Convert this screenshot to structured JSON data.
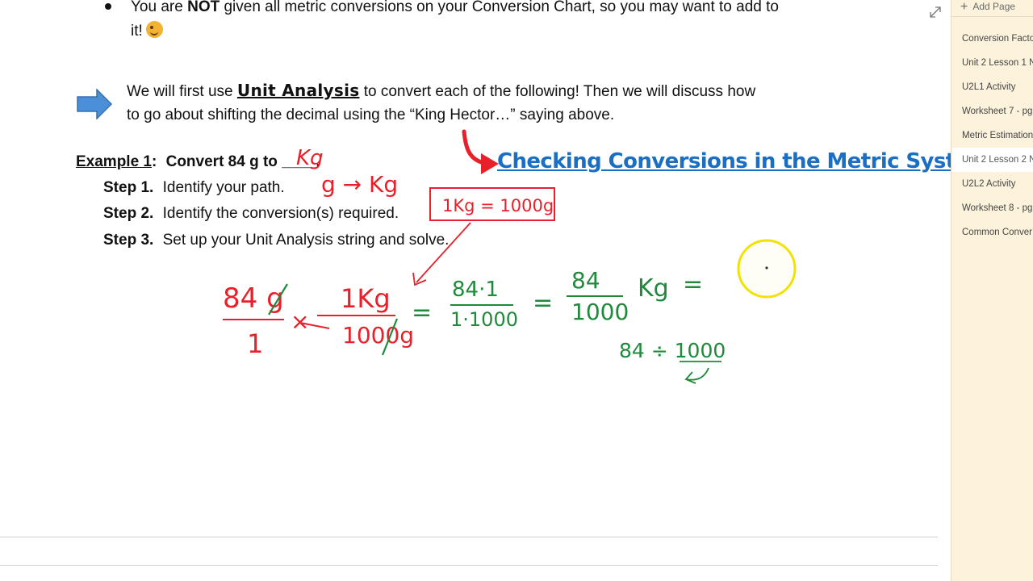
{
  "bullet": {
    "line1_a": "You are ",
    "line1_bold": "NOT",
    "line1_b": " given all metric conversions on your Conversion Chart, so you may want to add to",
    "line2": "it!",
    "emoji_icon": "winking-face-icon"
  },
  "intro": {
    "arrow_icon": "right-arrow-icon",
    "line1_a": "We will first use ",
    "line1_bold": "Unit Analysis",
    "line1_b": " to convert each of the following!  Then we will discuss how",
    "line2": "to go about shifting the decimal using the “King Hector…” saying above."
  },
  "example": {
    "label": "Example 1",
    "colon": ":",
    "title": "Convert 84 g to",
    "blank": "____",
    "period": ".",
    "steps": [
      {
        "num": "Step 1.",
        "text": "Identify your path."
      },
      {
        "num": "Step 2.",
        "text": "Identify the conversion(s) required."
      },
      {
        "num": "Step 3.",
        "text": "Set up your Unit Analysis string and solve."
      }
    ]
  },
  "link": {
    "text": "Checking Conversions in the Metric System"
  },
  "ink": {
    "blank_fill": "Kg",
    "path": "g → Kg",
    "box": "1Kg = 1000g",
    "frac1_num": "84 g",
    "frac1_den": "1",
    "times": "×",
    "frac2_num": "1Kg",
    "frac2_den": "1000g",
    "eq": "=",
    "frac3_num": "84·1",
    "frac3_den": "1·1000",
    "frac4_num": "84",
    "frac4_den": "1000",
    "unit": "Kg",
    "green_line": "84 ÷ 1000",
    "red_color": "#e8202a",
    "green_color": "#1f8a3c",
    "cursor_color": "#f2e200"
  },
  "sidebar": {
    "add_page": "Add Page",
    "pages": [
      {
        "label": "Conversion Factors",
        "selected": false
      },
      {
        "label": "Unit 2 Lesson 1 N",
        "selected": false
      },
      {
        "label": "U2L1 Activity",
        "selected": false
      },
      {
        "label": "Worksheet 7 - pg",
        "selected": false
      },
      {
        "label": "Metric Estimation",
        "selected": false
      },
      {
        "label": "Unit 2 Lesson 2 N",
        "selected": true
      },
      {
        "label": "U2L2 Activity",
        "selected": false
      },
      {
        "label": "Worksheet 8 - pg",
        "selected": false
      },
      {
        "label": "Common Conver",
        "selected": false
      }
    ]
  }
}
